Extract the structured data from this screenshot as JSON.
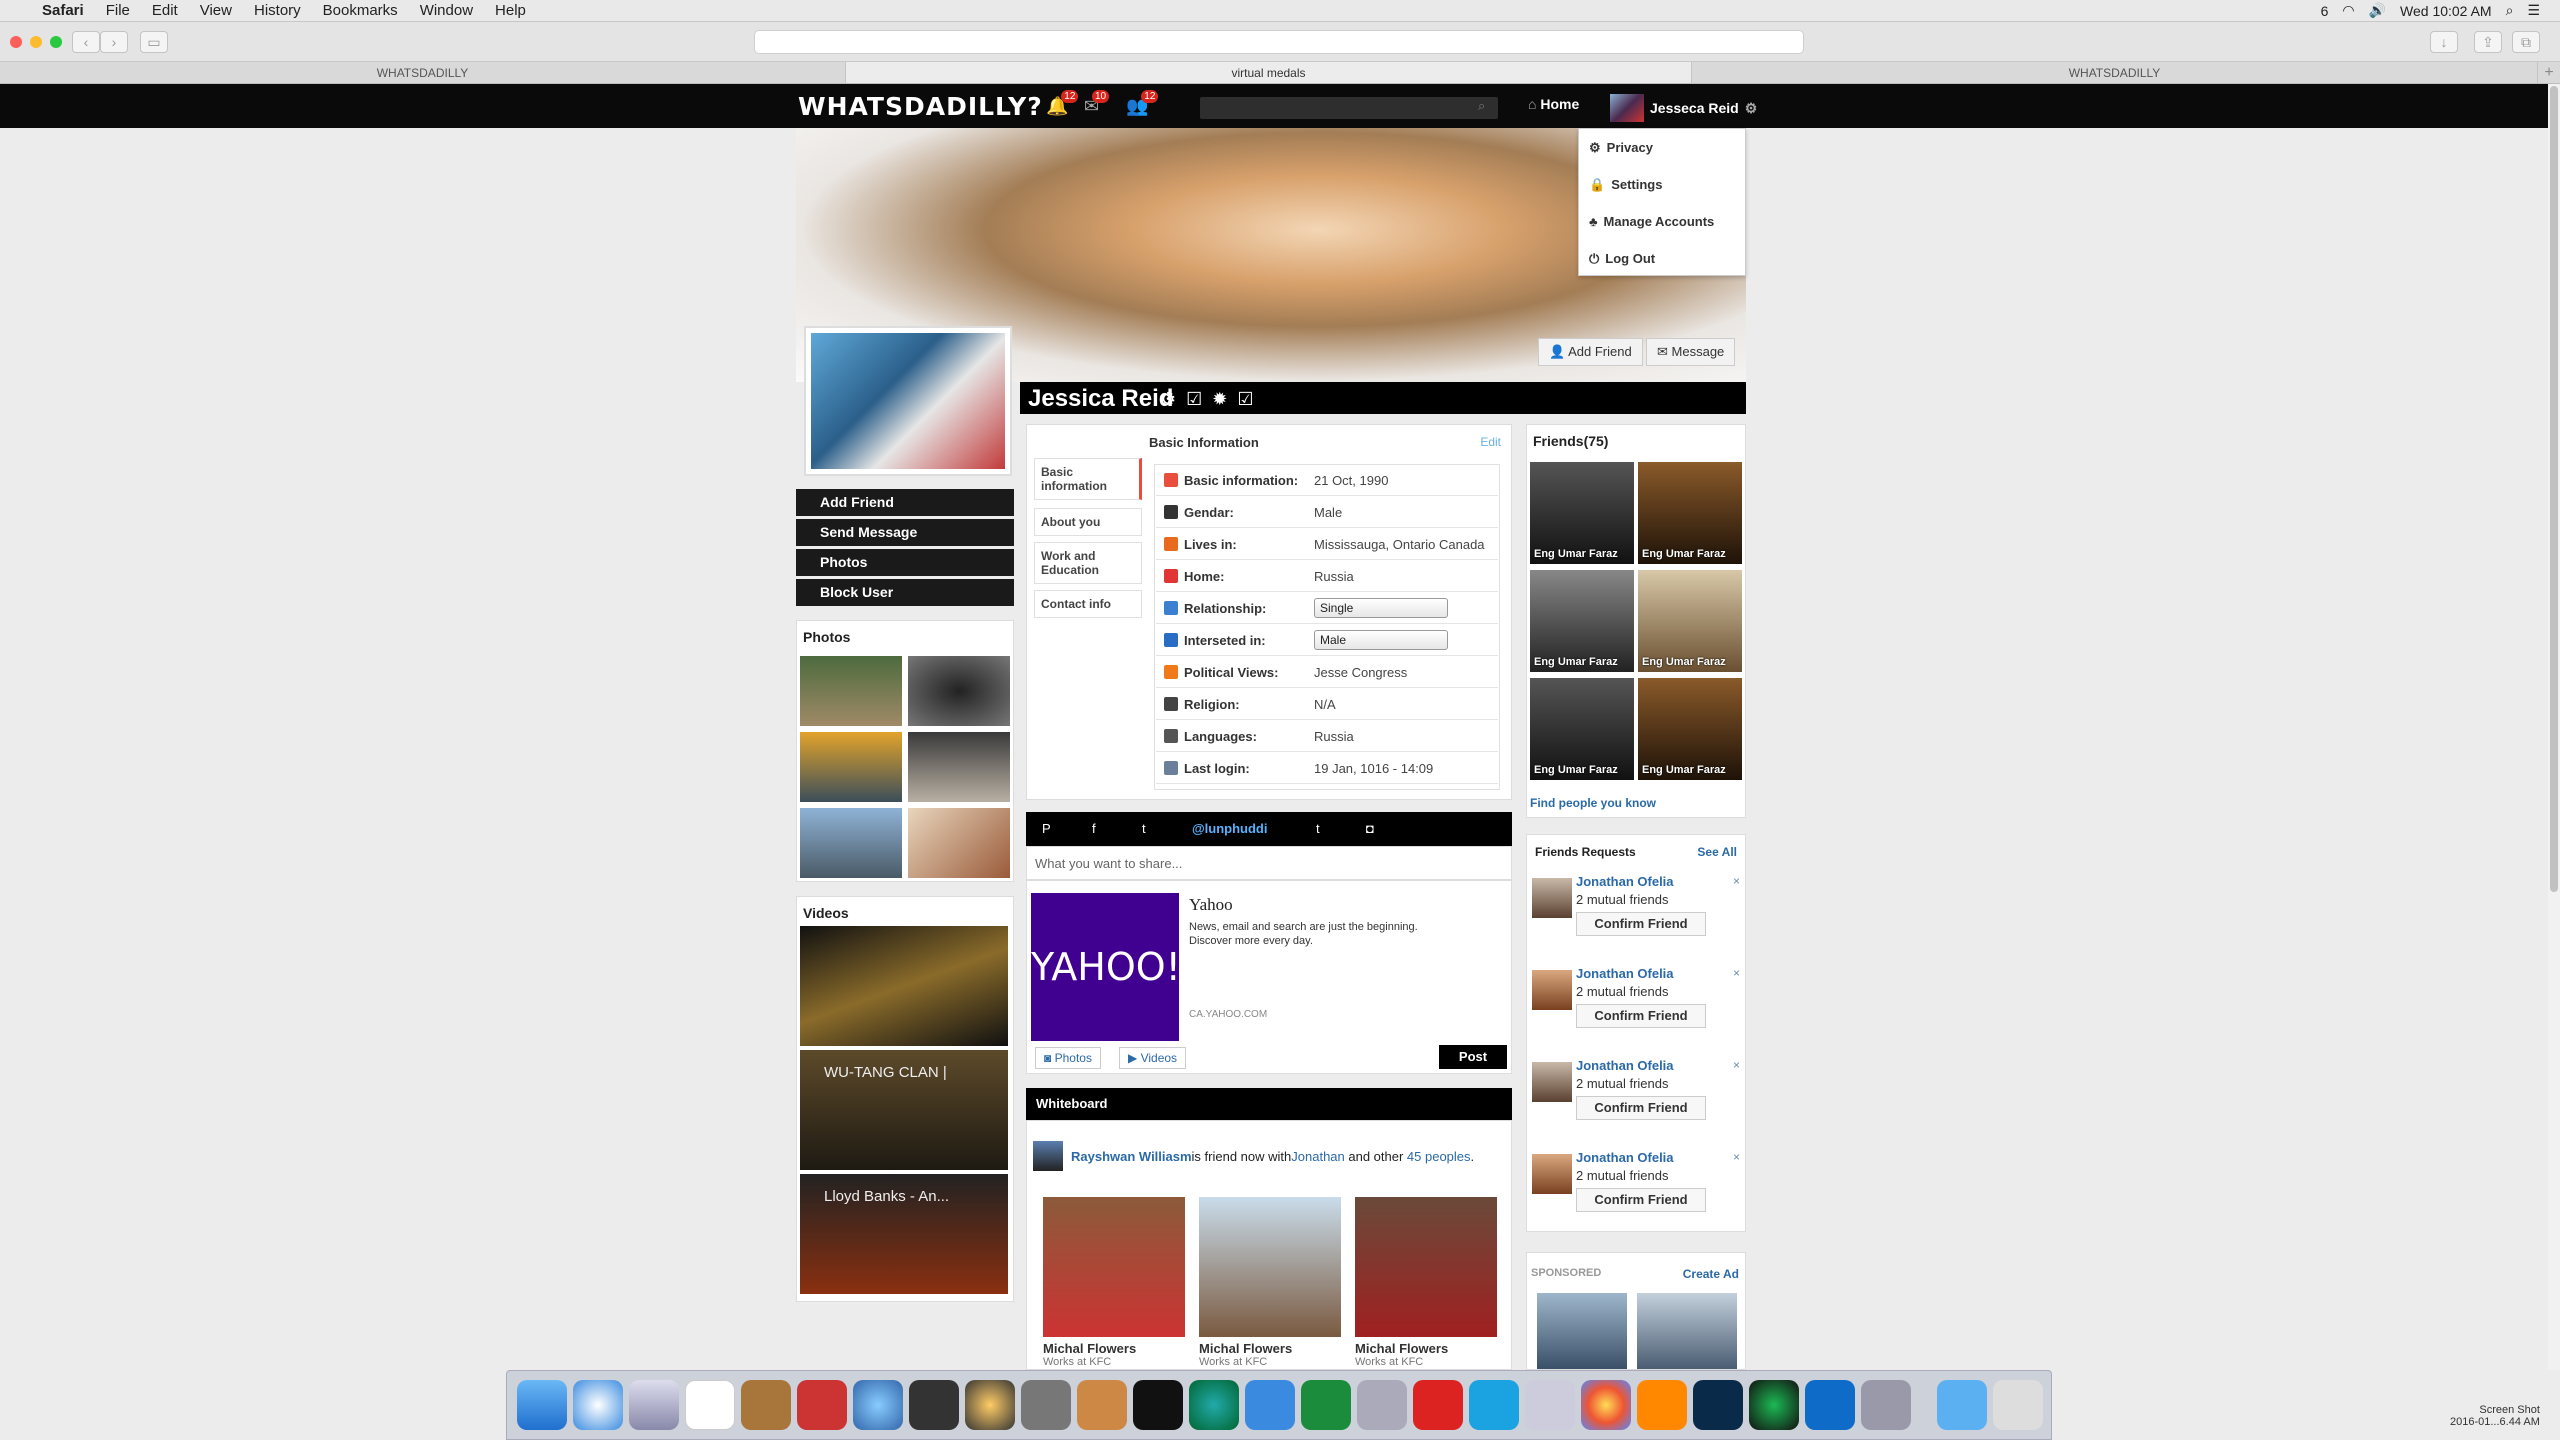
{
  "menubar": {
    "app": "Safari",
    "items": [
      "File",
      "Edit",
      "View",
      "History",
      "Bookmarks",
      "Window",
      "Help"
    ],
    "status": "6",
    "clock": "Wed 10:02 AM"
  },
  "tabs": [
    "WHATSDADILLY",
    "virtual medals",
    "WHATSDADILLY"
  ],
  "site": {
    "logo": "WHATSDADILLY?",
    "badges": [
      "12",
      "10",
      "12"
    ],
    "home": "Home",
    "user": "Jesseca Reid"
  },
  "dropdown": [
    "Privacy",
    "Settings",
    "Manage Accounts",
    "Log Out"
  ],
  "profile": {
    "name": "Jessica Reid",
    "add_friend": "Add Friend",
    "message": "Message"
  },
  "left_buttons": [
    "Add Friend",
    "Send Message",
    "Photos",
    "Block User"
  ],
  "photos_title": "Photos",
  "videos": {
    "title": "Videos",
    "items": [
      "",
      "WU-TANG CLAN |",
      "Lloyd Banks - An..."
    ]
  },
  "info": {
    "title": "Basic Information",
    "edit": "Edit",
    "tabs": [
      "Basic information",
      "About you",
      "Work and Education",
      "Contact info"
    ],
    "rows": [
      {
        "label": "Basic information:",
        "value": "21 Oct, 1990",
        "color": "#e84f3d"
      },
      {
        "label": "Gendar:",
        "value": "Male",
        "color": "#333333"
      },
      {
        "label": "Lives in:",
        "value": "Mississauga, Ontario Canada",
        "color": "#e86a1d"
      },
      {
        "label": "Home:",
        "value": "Russia",
        "color": "#e03535"
      },
      {
        "label": "Relationship:",
        "value": "Single",
        "color": "#3a7fd0"
      },
      {
        "label": "Interseted in:",
        "value": "Male",
        "color": "#2b6cc4"
      },
      {
        "label": "Political Views:",
        "value": "Jesse Congress",
        "color": "#f07a1a"
      },
      {
        "label": "Religion:",
        "value": "N/A",
        "color": "#444444"
      },
      {
        "label": "Languages:",
        "value": "Russia",
        "color": "#555555"
      },
      {
        "label": "Last login:",
        "value": "19 Jan, 1016 - 14:09",
        "color": "#6a7f99"
      }
    ]
  },
  "social": {
    "handle": "@lunphuddi",
    "share_placeholder": "What you want to share..."
  },
  "yahoo": {
    "logo": "YAHOO!",
    "title": "Yahoo",
    "desc1": "News, email and search are just the beginning.",
    "desc2": "Discover more every day.",
    "url": "CA.YAHOO.COM",
    "photos": "Photos",
    "videos": "Videos",
    "post": "Post"
  },
  "whiteboard": {
    "title": "Whiteboard",
    "actor": "Rayshwan Williasm",
    "text1": "is friend now with",
    "friend": "Jonathan",
    "text2": " and other ",
    "others": "45 peoples",
    "cards": [
      {
        "name": "Michal Flowers",
        "sub": "Works at KFC"
      },
      {
        "name": "Michal Flowers",
        "sub": "Works at KFC"
      },
      {
        "name": "Michal Flowers",
        "sub": "Works at KFC"
      }
    ]
  },
  "friends": {
    "title": "Friends(75)",
    "names": [
      "Eng Umar Faraz",
      "Eng Umar Faraz",
      "Eng Umar Faraz",
      "Eng Umar Faraz",
      "Eng Umar Faraz",
      "Eng Umar Faraz"
    ],
    "find": "Find people you know"
  },
  "requests": {
    "title": "Friends Requests",
    "see_all": "See All",
    "items": [
      {
        "name": "Jonathan Ofelia",
        "mutual": "2 mutual friends",
        "confirm": "Confirm Friend"
      },
      {
        "name": "Jonathan Ofelia",
        "mutual": "2 mutual friends",
        "confirm": "Confirm Friend"
      },
      {
        "name": "Jonathan Ofelia",
        "mutual": "2 mutual friends",
        "confirm": "Confirm Friend"
      },
      {
        "name": "Jonathan Ofelia",
        "mutual": "2 mutual friends",
        "confirm": "Confirm Friend"
      }
    ]
  },
  "sponsored": {
    "title": "SPONSORED",
    "create": "Create Ad"
  },
  "screenshot_label": {
    "line1": "Screen Shot",
    "line2": "2016-01...6.44 AM"
  }
}
